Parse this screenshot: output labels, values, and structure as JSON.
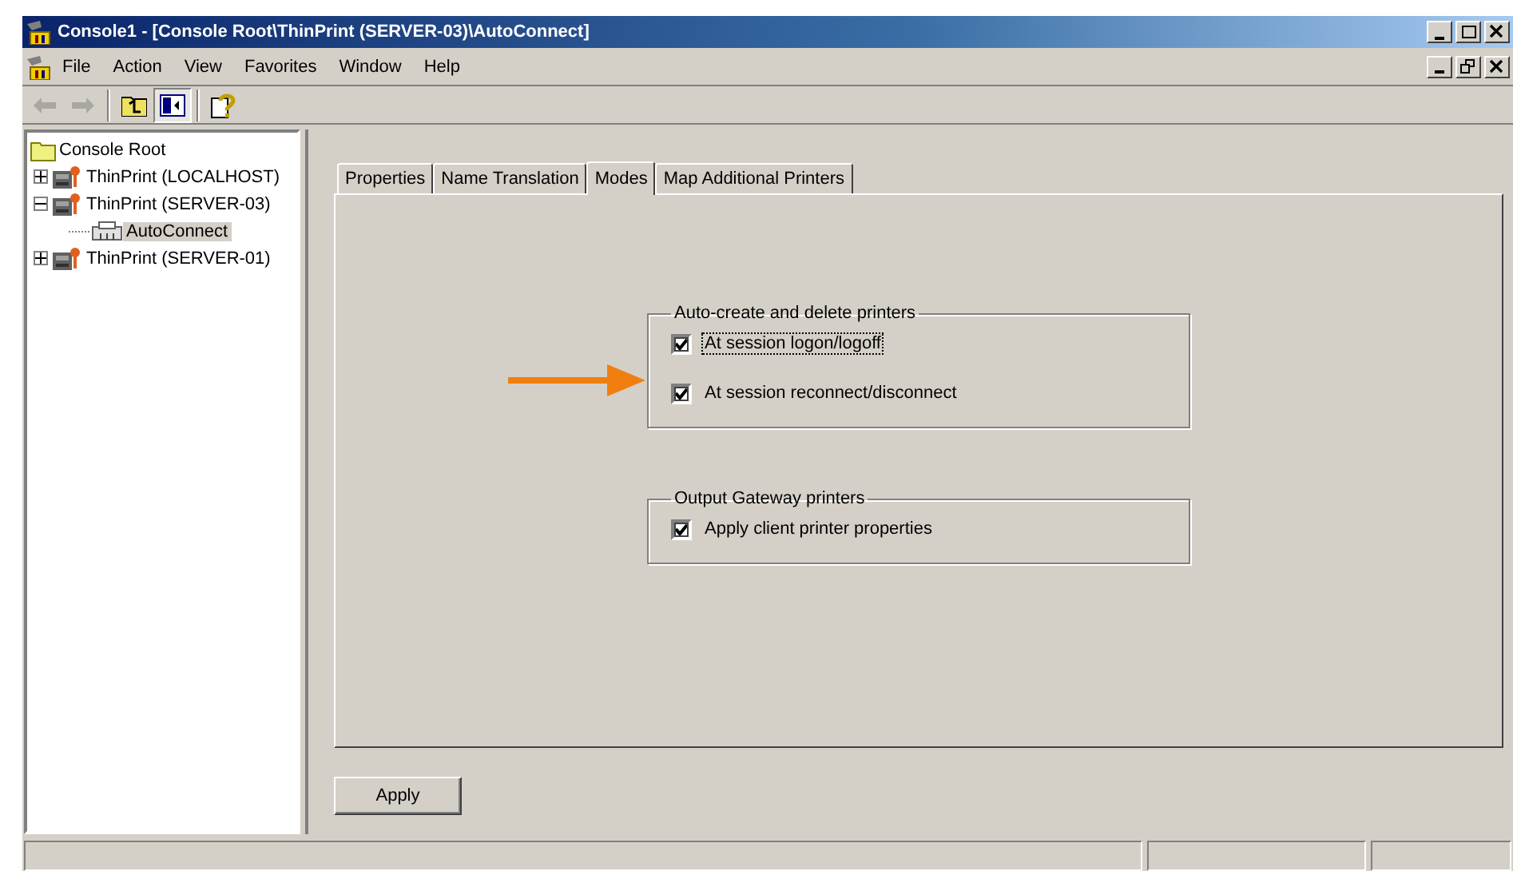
{
  "window": {
    "title": "Console1 - [Console Root\\ThinPrint (SERVER-03)\\AutoConnect]",
    "controls": [
      {
        "kind": "minimize"
      },
      {
        "kind": "maximize"
      },
      {
        "kind": "close"
      }
    ]
  },
  "menu_bar": {
    "items": [
      "File",
      "Action",
      "View",
      "Favorites",
      "Window",
      "Help"
    ],
    "controls": [
      {
        "kind": "minimize"
      },
      {
        "kind": "restore"
      },
      {
        "kind": "close"
      }
    ]
  },
  "toolbar": [
    {
      "kind": "back",
      "disabled": true
    },
    {
      "kind": "forward",
      "disabled": true
    },
    {
      "kind": "up",
      "disabled": false
    },
    {
      "kind": "tree",
      "disabled": false,
      "pressed": true
    },
    {
      "kind": "help",
      "disabled": false
    }
  ],
  "tree": [
    {
      "label": "Console Root",
      "kind": "folder",
      "selected": false,
      "children": [
        {
          "label": "ThinPrint (LOCALHOST)",
          "kind": "server",
          "selected": false,
          "expanded": false
        },
        {
          "label": "ThinPrint (SERVER-03)",
          "kind": "server",
          "selected": false,
          "expanded": true,
          "children": [
            {
              "label": "AutoConnect",
              "kind": "connect",
              "selected": true
            }
          ]
        },
        {
          "label": "ThinPrint (SERVER-01)",
          "kind": "server",
          "selected": false,
          "expanded": false
        }
      ]
    }
  ],
  "tabs": [
    {
      "label": "Properties",
      "selected": false
    },
    {
      "label": "Name Translation",
      "selected": false
    },
    {
      "label": "Modes",
      "selected": true
    },
    {
      "label": "Map Additional Printers",
      "selected": false
    }
  ],
  "groups": [
    {
      "title": "Auto-create and delete printers",
      "options": [
        {
          "label": "At session logon/logoff",
          "checked": true,
          "focused": true
        },
        {
          "label": "At session reconnect/disconnect",
          "checked": true,
          "focused": false
        }
      ]
    },
    {
      "title": "Output Gateway printers",
      "options": [
        {
          "label": "Apply client printer properties",
          "checked": true,
          "focused": false
        }
      ]
    }
  ],
  "apply_button": "Apply"
}
